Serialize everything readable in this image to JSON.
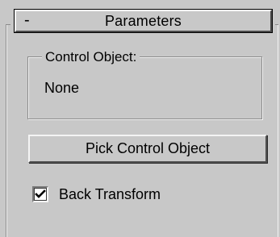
{
  "rollout": {
    "collapse_symbol": "-",
    "title": "Parameters"
  },
  "control_object_group": {
    "legend": "Control Object:",
    "value": "None"
  },
  "pick_button": {
    "label": "Pick Control Object"
  },
  "back_transform": {
    "label": "Back Transform",
    "checked": true
  },
  "icons": {
    "checkmark": "checkmark-icon"
  }
}
